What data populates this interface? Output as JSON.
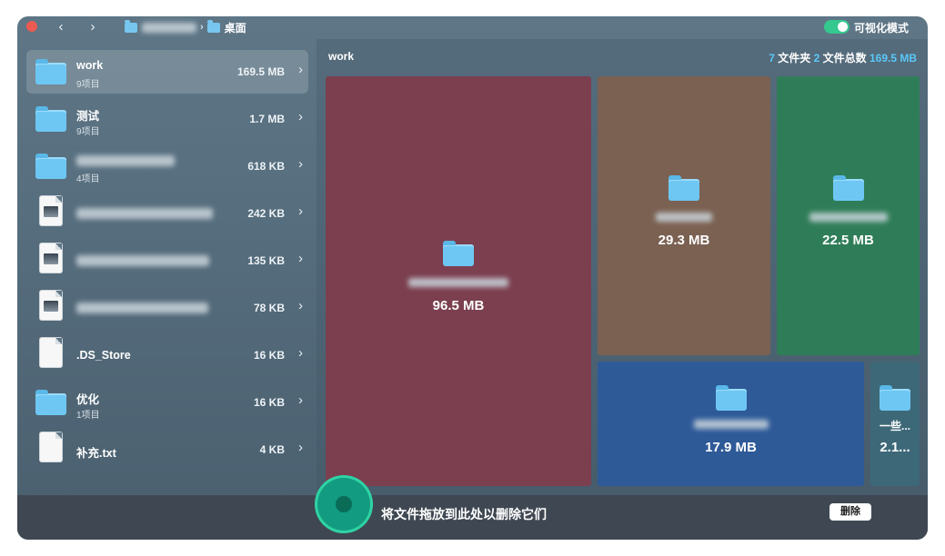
{
  "titlebar": {
    "nav_back": "‹",
    "nav_forward": "›",
    "crumb_current": "桌面",
    "visual_mode_label": "可视化模式"
  },
  "sidebar": {
    "items": [
      {
        "name": "work",
        "sub": "9项目",
        "size": "169.5 MB",
        "kind": "folder",
        "selected": true
      },
      {
        "name": "测试",
        "sub": "9项目",
        "size": "1.7 MB",
        "kind": "folder"
      },
      {
        "name": "",
        "sub": "4项目",
        "size": "618 KB",
        "kind": "folder"
      },
      {
        "name": "",
        "sub": "",
        "size": "242 KB",
        "kind": "image"
      },
      {
        "name": "",
        "sub": "",
        "size": "135 KB",
        "kind": "image"
      },
      {
        "name": "",
        "sub": "",
        "size": "78 KB",
        "kind": "image"
      },
      {
        "name": ".DS_Store",
        "sub": "",
        "size": "16 KB",
        "kind": "file"
      },
      {
        "name": "优化",
        "sub": "1项目",
        "size": "16 KB",
        "kind": "folder"
      },
      {
        "name": "补充.txt",
        "sub": "",
        "size": "4 KB",
        "kind": "text"
      }
    ]
  },
  "main": {
    "title": "work",
    "summary": {
      "folders_count": "7",
      "folders_label": "文件夹",
      "files_count": "2",
      "files_label": "文件总数",
      "total": "169.5 MB"
    },
    "tiles": [
      {
        "size": "96.5 MB",
        "color": "#7b3f4f"
      },
      {
        "size": "29.3 MB",
        "color": "#7b6152"
      },
      {
        "size": "22.5 MB",
        "color": "#2f7d58"
      },
      {
        "size": "17.9 MB",
        "color": "#2e5a98"
      },
      {
        "name": "一些...",
        "size": "2.1...",
        "color": "#3d6878"
      }
    ]
  },
  "bottom": {
    "drop_text": "将文件拖放到此处以删除它们",
    "delete_label": "删除"
  },
  "colors": {
    "accent": "#5ac8fa",
    "toggle": "#35c88f",
    "drop_zone": "#139b81"
  }
}
